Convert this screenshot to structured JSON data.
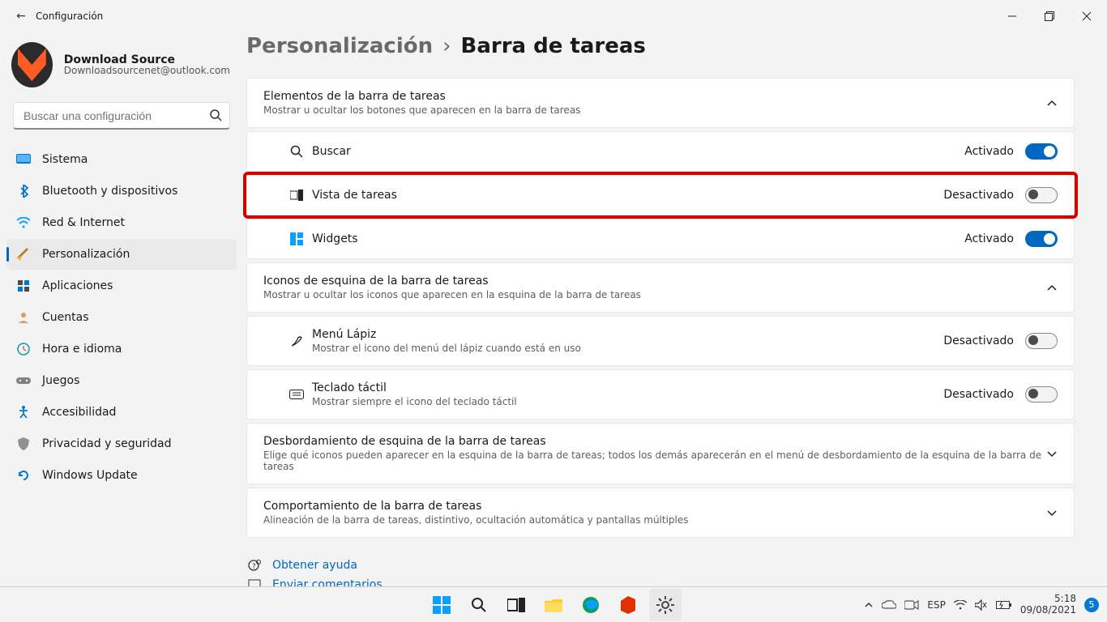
{
  "titlebar": {
    "back_icon": "←",
    "app_name": "Configuración",
    "min": "—",
    "max": "❐",
    "close": "✕"
  },
  "user": {
    "name": "Download Source",
    "email": "Downloadsourcenet@outlook.com"
  },
  "search": {
    "placeholder": "Buscar una configuración"
  },
  "nav": {
    "items": [
      {
        "icon": "💻",
        "label": "Sistema"
      },
      {
        "icon": "bt",
        "label": "Bluetooth y dispositivos"
      },
      {
        "icon": "📶",
        "label": "Red & Internet"
      },
      {
        "icon": "🖌",
        "label": "Personalización",
        "active": true
      },
      {
        "icon": "▦",
        "label": "Aplicaciones"
      },
      {
        "icon": "👤",
        "label": "Cuentas"
      },
      {
        "icon": "🕓",
        "label": "Hora e idioma"
      },
      {
        "icon": "🎮",
        "label": "Juegos"
      },
      {
        "icon": "✋",
        "label": "Accesibilidad"
      },
      {
        "icon": "🛡",
        "label": "Privacidad y seguridad"
      },
      {
        "icon": "🔄",
        "label": "Windows Update"
      }
    ]
  },
  "crumbs": {
    "parent": "Personalización",
    "sep": "›",
    "current": "Barra de tareas"
  },
  "sections": {
    "s1": {
      "title": "Elementos de la barra de tareas",
      "sub": "Mostrar u ocultar los botones que aparecen en la barra de tareas"
    },
    "s1rows": [
      {
        "icon": "🔍",
        "label": "Buscar",
        "status": "Activado",
        "on": true,
        "highlight": false
      },
      {
        "icon": "▣",
        "label": "Vista de tareas",
        "status": "Desactivado",
        "on": false,
        "highlight": true
      },
      {
        "icon": "◫",
        "label": "Widgets",
        "status": "Activado",
        "on": true,
        "highlight": false
      }
    ],
    "s2": {
      "title": "Iconos de esquina de la barra de tareas",
      "sub": "Mostrar u ocultar los iconos que aparecen en la esquina de la barra de tareas"
    },
    "s2rows": [
      {
        "icon": "✎",
        "label": "Menú Lápiz",
        "sub": "Mostrar el icono del menú del lápiz cuando está en uso",
        "status": "Desactivado",
        "on": false
      },
      {
        "icon": "⌨",
        "label": "Teclado táctil",
        "sub": "Mostrar siempre el icono del teclado táctil",
        "status": "Desactivado",
        "on": false
      }
    ],
    "s3": {
      "title": "Desbordamiento de esquina de la barra de tareas",
      "sub": "Elige qué iconos pueden aparecer en la esquina de la barra de tareas; todos los demás aparecerán en el menú de desbordamiento de la esquina de la barra de tareas"
    },
    "s4": {
      "title": "Comportamiento de la barra de tareas",
      "sub": "Alineación de la barra de tareas, distintivo, ocultación automática y pantallas múltiples"
    }
  },
  "help": {
    "label": "Obtener ayuda",
    "feedback": "Enviar comentarios"
  },
  "status": {
    "on": "Activado",
    "off": "Desactivado"
  },
  "taskbar": {
    "lang": "ESP",
    "time": "5:18",
    "date": "09/08/2021"
  }
}
